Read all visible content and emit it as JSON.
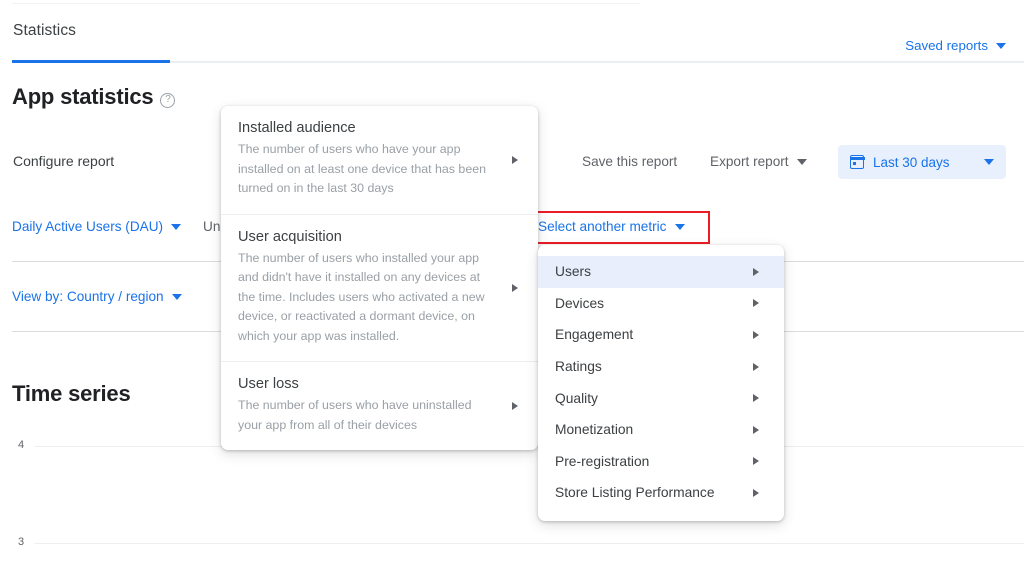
{
  "header": {
    "tab_label": "Statistics",
    "saved_reports_label": "Saved reports",
    "saved_reports_caret": "chevron-down-icon",
    "accent_color": "#1a73e8"
  },
  "page": {
    "title": "App statistics",
    "help_glyph": "?"
  },
  "configure": {
    "label": "Configure report",
    "save_report_label": "Save this report",
    "export_report_label": "Export report",
    "date_range_label": "Last 30 days",
    "calendar_icon": "calendar-icon"
  },
  "metrics": {
    "primary_label": "Daily Active Users (DAU)",
    "secondary_label": "Un",
    "select_another_label": "Select another metric",
    "view_by_label": "View by: Country / region",
    "highlight_color": "#ec1c24"
  },
  "flyout": {
    "items": [
      {
        "title": "Installed audience",
        "description": "The number of users who have your app installed on at least one device that has been turned on in the last 30 days",
        "arrow": "triangle-right-icon"
      },
      {
        "title": "User acquisition",
        "description": "The number of users who installed your app and didn't have it installed on any devices at the time. Includes users who activated a new device, or reactivated a dormant device, on which your app was installed.",
        "arrow": "triangle-right-icon"
      },
      {
        "title": "User loss",
        "description": "The number of users who have uninstalled your app from all of their devices",
        "arrow": "triangle-right-icon"
      }
    ]
  },
  "metric_menu": {
    "items": [
      {
        "label": "Users",
        "selected": true
      },
      {
        "label": "Devices",
        "selected": false
      },
      {
        "label": "Engagement",
        "selected": false
      },
      {
        "label": "Ratings",
        "selected": false
      },
      {
        "label": "Quality",
        "selected": false
      },
      {
        "label": "Monetization",
        "selected": false
      },
      {
        "label": "Pre-registration",
        "selected": false
      },
      {
        "label": "Store Listing Performance",
        "selected": false
      }
    ]
  },
  "time_series": {
    "title": "Time series"
  },
  "chart_data": {
    "type": "line",
    "title": "Time series",
    "xlabel": "",
    "ylabel": "",
    "series": [],
    "x": [],
    "ytick_labels": [
      "4",
      "3"
    ],
    "ytick_values": [
      4,
      3
    ],
    "ylim": [
      3,
      4
    ],
    "grid": true,
    "legend": "none"
  }
}
